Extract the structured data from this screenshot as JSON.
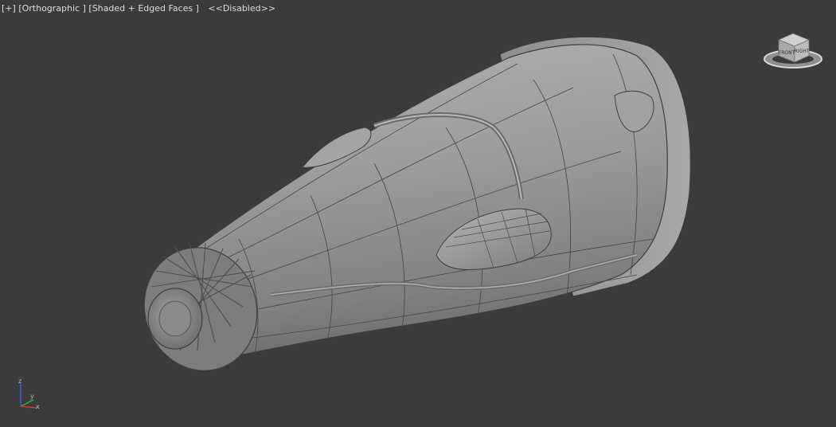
{
  "viewport": {
    "plus_menu": "[+]",
    "view_mode": "[Orthographic ]",
    "shading_mode": "[Shaded + Edged Faces ]",
    "status": "<<Disabled>>"
  },
  "viewcube": {
    "faces": {
      "front": "FRONT",
      "right": "RIGHT"
    }
  },
  "axis_tripod": {
    "z": "z",
    "y": "y",
    "x": "x"
  },
  "colors": {
    "background": "#3b3b3b",
    "model_surface": "#9c9c9c",
    "edge_lines": "#3e3e3e",
    "axis_x": "#d23a3a",
    "axis_y": "#3ab44a",
    "axis_z": "#3a5ad2"
  }
}
